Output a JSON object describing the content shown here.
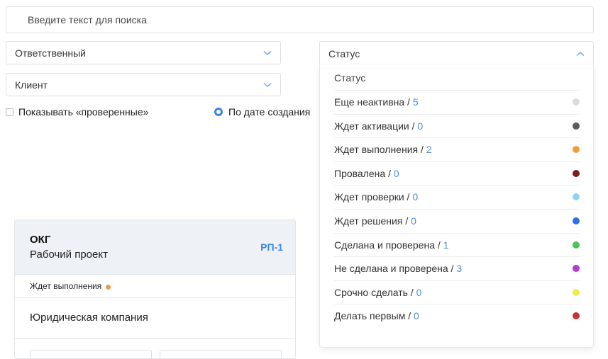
{
  "search": {
    "placeholder": "Введите текст для поиска"
  },
  "filters": {
    "responsible": "Ответственный",
    "client": "Клиент",
    "status": "Статус",
    "show_checked_label": "Показывать «проверенные»",
    "sort_label": "По дате создания"
  },
  "card": {
    "title": "ОКГ",
    "subtitle": "Рабочий проект",
    "code": "РП-1",
    "status_label": "Ждет выполнения",
    "status_color": "#eba03d",
    "company": "Юридическая компания"
  },
  "status_dropdown": {
    "header": "Статус",
    "items": [
      {
        "label": "Еще неактивна",
        "count": "5",
        "color": "#dcdcdc"
      },
      {
        "label": "Ждет активации",
        "count": "0",
        "color": "#5c5c5c"
      },
      {
        "label": "Ждет выполнения",
        "count": "2",
        "color": "#eba03d"
      },
      {
        "label": "Провалена",
        "count": "0",
        "color": "#7a1e1e"
      },
      {
        "label": "Ждет проверки",
        "count": "0",
        "color": "#8fd3f0"
      },
      {
        "label": "Ждет решения",
        "count": "0",
        "color": "#2f6fe6"
      },
      {
        "label": "Сделана и проверена",
        "count": "1",
        "color": "#4cc25b"
      },
      {
        "label": "Не сделана и проверена",
        "count": "3",
        "color": "#b43ad8"
      },
      {
        "label": "Срочно сделать",
        "count": "0",
        "color": "#f4ea45"
      },
      {
        "label": "Делать первым",
        "count": "0",
        "color": "#c23535"
      }
    ]
  },
  "colors": {
    "accent": "#3a86e6",
    "link_count": "#4a8fe0"
  }
}
